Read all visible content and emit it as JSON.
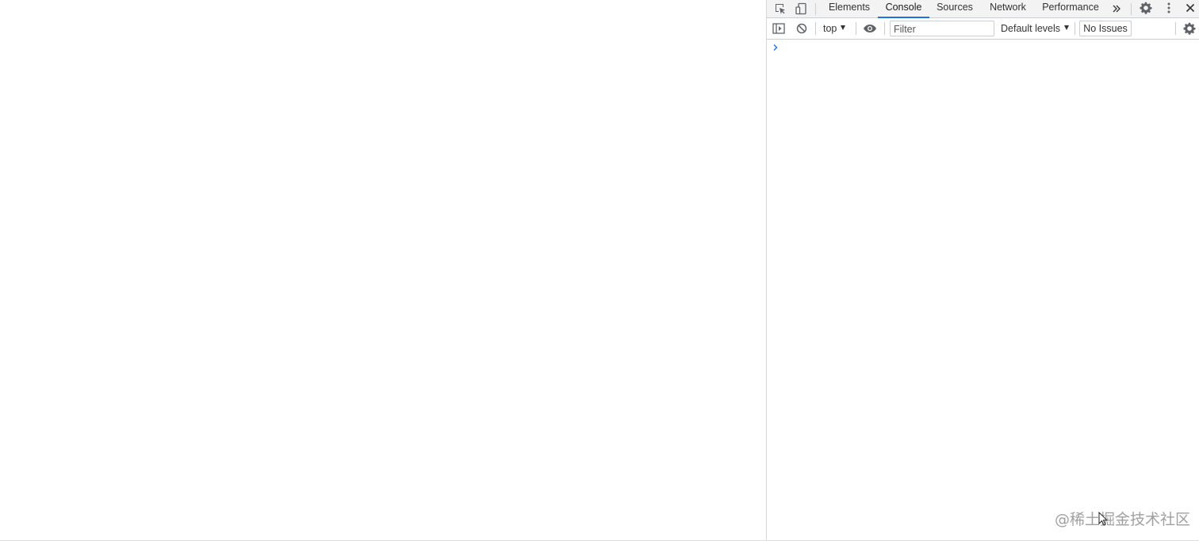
{
  "devtools": {
    "tabs": [
      {
        "label": "Elements",
        "active": false
      },
      {
        "label": "Console",
        "active": true
      },
      {
        "label": "Sources",
        "active": false
      },
      {
        "label": "Network",
        "active": false
      },
      {
        "label": "Performance",
        "active": false
      }
    ],
    "toolbar_icons": [
      "inspect-element-icon",
      "device-toolbar-icon",
      "more-tabs-icon",
      "settings-icon",
      "kebab-menu-icon",
      "close-icon"
    ],
    "accent_color": "#1a73e8"
  },
  "console": {
    "context_select": "top",
    "filter_placeholder": "Filter",
    "levels_select": "Default levels",
    "issues_label": "No Issues",
    "prompt_symbol": "›",
    "toolbar_icons": [
      "sidebar-toggle-icon",
      "clear-console-icon",
      "live-expression-eye-icon",
      "console-settings-icon"
    ]
  },
  "watermark": {
    "text": "@稀土掘金技术社区"
  }
}
